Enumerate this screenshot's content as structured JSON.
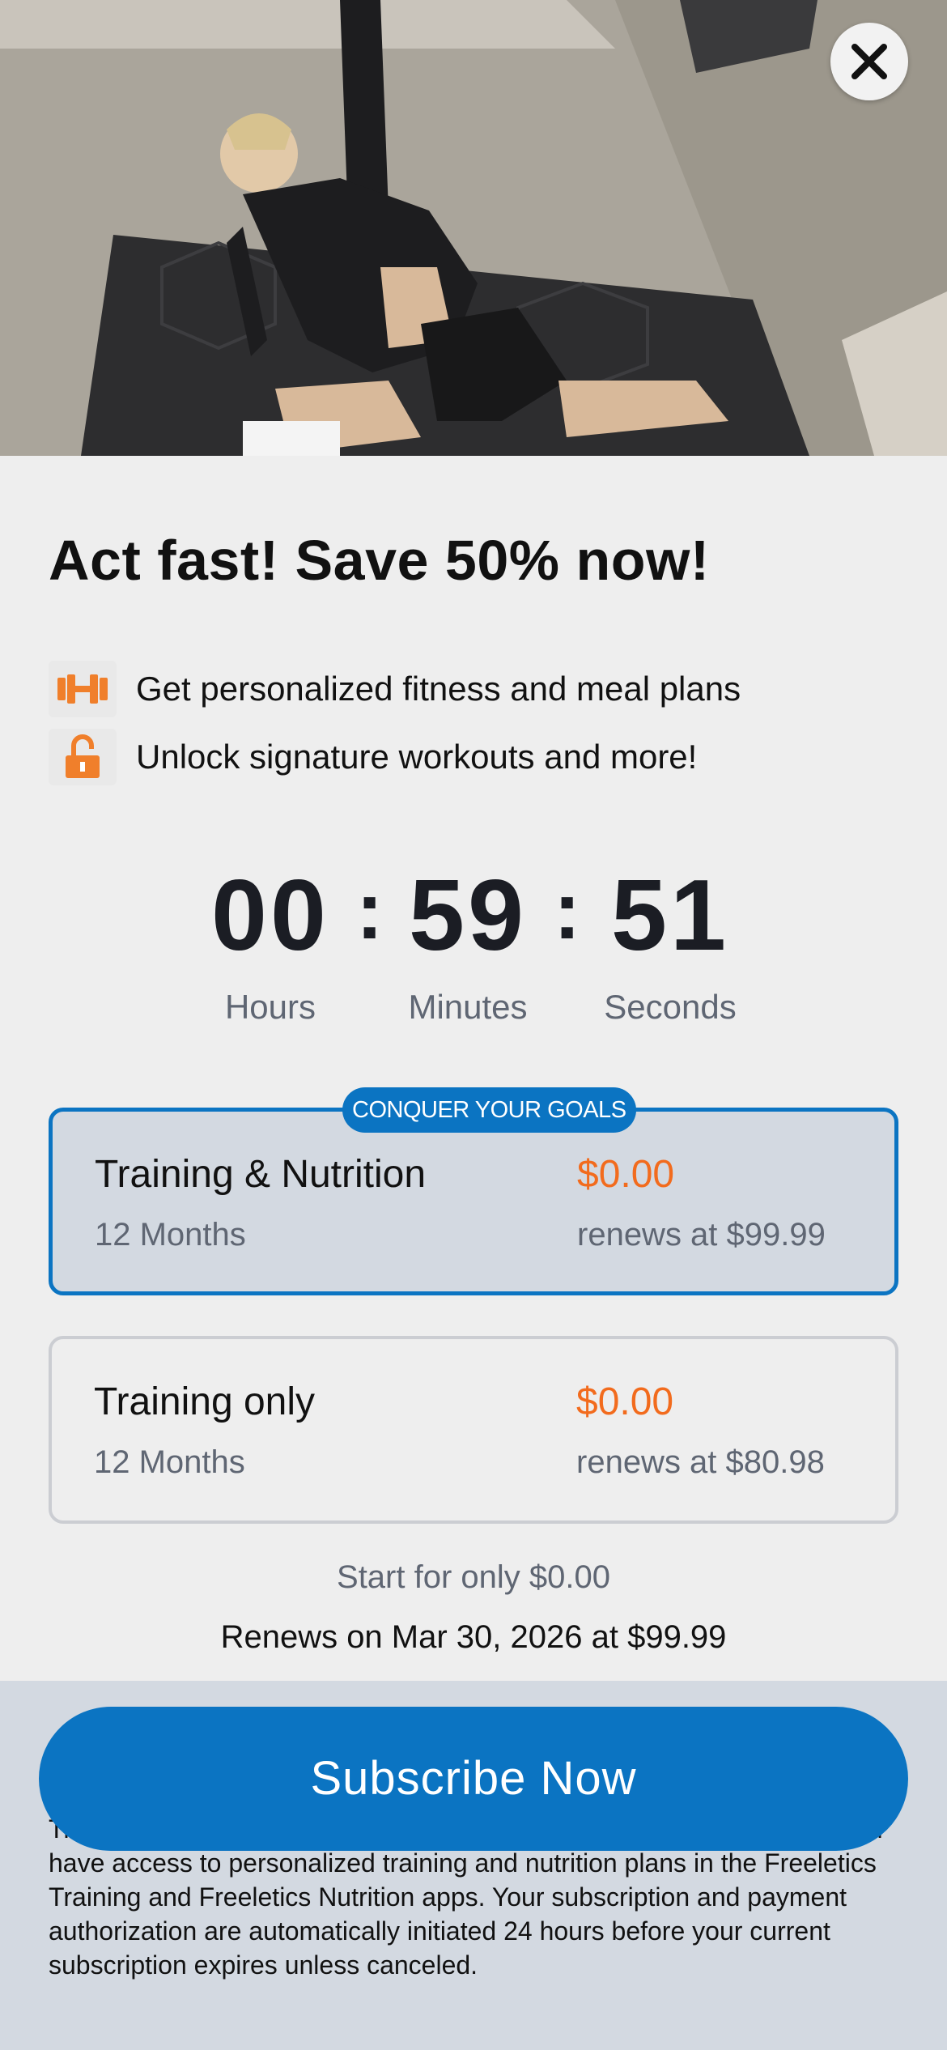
{
  "hero": {
    "image": "woman-stretching-on-yoga-mat-photo"
  },
  "close": {
    "icon": "close-icon"
  },
  "headline": "Act fast! Save 50% now!",
  "features": [
    {
      "icon": "dumbbell-icon",
      "text": "Get personalized fitness and meal plans"
    },
    {
      "icon": "unlock-icon",
      "text": "Unlock signature workouts and more!"
    }
  ],
  "countdown": {
    "hours": "00",
    "minutes": "59",
    "seconds": "51",
    "hours_label": "Hours",
    "minutes_label": "Minutes",
    "seconds_label": "Seconds"
  },
  "plans": [
    {
      "badge": "CONQUER YOUR GOALS",
      "name": "Training & Nutrition",
      "duration": "12 Months",
      "price": "$0.00",
      "renewal": "renews at $99.99",
      "selected": true
    },
    {
      "name": "Training only",
      "duration": "12 Months",
      "price": "$0.00",
      "renewal": "renews at $80.98",
      "selected": false
    }
  ],
  "summary": {
    "start": "Start for only $0.00",
    "renews": "Renews on Mar 30, 2026 at $99.99"
  },
  "cta": {
    "label": "Subscribe Now"
  },
  "legal": {
    "text": "Coach have access to personalized training plans in the Freeletics Training app, while users who purchase the Training and Nutrition Coach have access to personalized training and nutrition plans in the Freeletics Training and Freeletics Nutrition apps. Your subscription and payment authorization are automatically initiated 24 hours before your current subscription expires unless canceled."
  },
  "colors": {
    "accent": "#0b74c2",
    "price": "#f26b1d",
    "muted": "#5f6673"
  }
}
